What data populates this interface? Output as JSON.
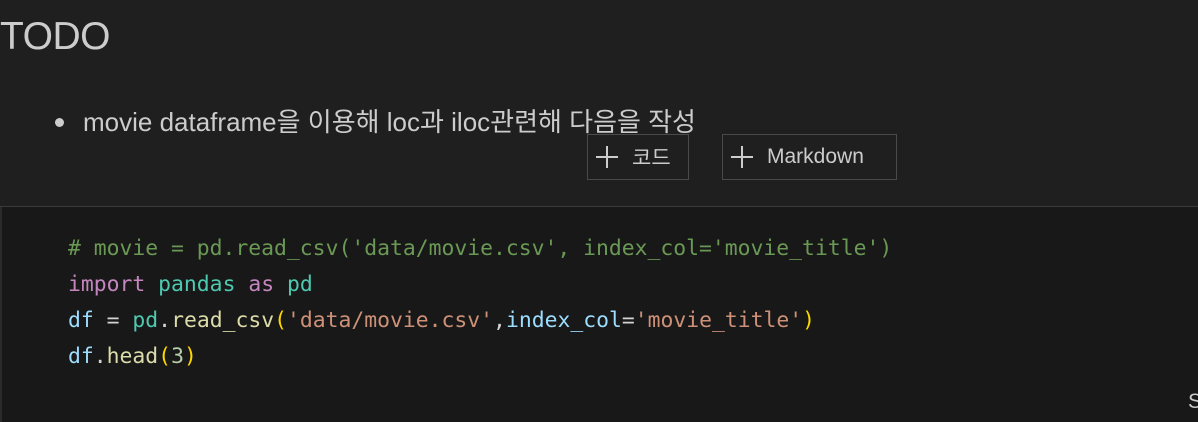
{
  "markdown_cell": {
    "heading": "TODO",
    "bullets": [
      "movie dataframe을 이용해 loc과 iloc관련해 다음을 작성"
    ]
  },
  "toolbar": {
    "add_code_label": "코드",
    "add_markdown_label": "Markdown"
  },
  "code_cell": {
    "lines": [
      [
        {
          "t": "# movie = pd.read_csv('data/movie.csv', index_col='movie_title')",
          "c": "comment"
        }
      ],
      [
        {
          "t": "import",
          "c": "keyword"
        },
        {
          "t": " ",
          "c": "plain"
        },
        {
          "t": "pandas",
          "c": "module"
        },
        {
          "t": " ",
          "c": "plain"
        },
        {
          "t": "as",
          "c": "keyword"
        },
        {
          "t": " ",
          "c": "plain"
        },
        {
          "t": "pd",
          "c": "module"
        }
      ],
      [
        {
          "t": "df",
          "c": "var"
        },
        {
          "t": " = ",
          "c": "plain"
        },
        {
          "t": "pd",
          "c": "module"
        },
        {
          "t": ".",
          "c": "plain"
        },
        {
          "t": "read_csv",
          "c": "func"
        },
        {
          "t": "(",
          "c": "paren"
        },
        {
          "t": "'data/movie.csv'",
          "c": "str"
        },
        {
          "t": ",",
          "c": "plain"
        },
        {
          "t": "index_col",
          "c": "var"
        },
        {
          "t": "=",
          "c": "plain"
        },
        {
          "t": "'movie_title'",
          "c": "str"
        },
        {
          "t": ")",
          "c": "paren"
        }
      ],
      [
        {
          "t": "df",
          "c": "var"
        },
        {
          "t": ".",
          "c": "plain"
        },
        {
          "t": "head",
          "c": "func"
        },
        {
          "t": "(",
          "c": "paren"
        },
        {
          "t": "3",
          "c": "num"
        },
        {
          "t": ")",
          "c": "paren"
        }
      ]
    ]
  },
  "corner_text": "S"
}
